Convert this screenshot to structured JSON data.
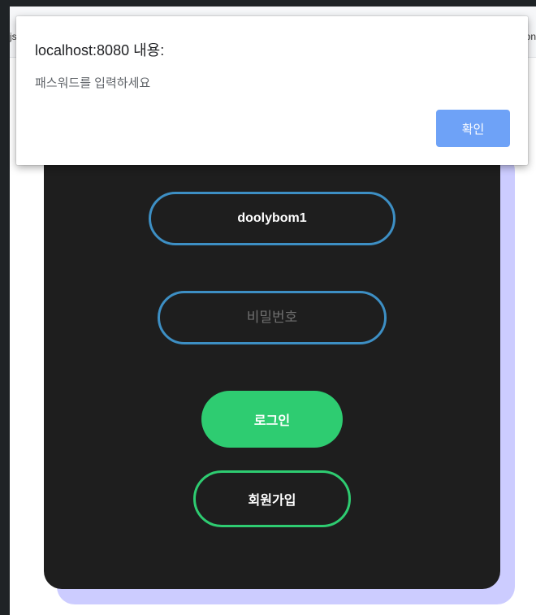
{
  "background": {
    "left_text": "js",
    "right_text": "on"
  },
  "login_form": {
    "username_value": "doolybom1",
    "password_placeholder": "비밀번호",
    "login_label": "로그인",
    "signup_label": "회원가입"
  },
  "dialog": {
    "title": "localhost:8080 내용:",
    "message": "패스워드를 입력하세요",
    "ok_label": "확인"
  },
  "colors": {
    "card_background": "#1e1e1e",
    "card_shadow": "#ccccff",
    "input_border": "#3d8fc4",
    "accent_green": "#2ecc71",
    "dialog_button": "#6ea2f7"
  }
}
